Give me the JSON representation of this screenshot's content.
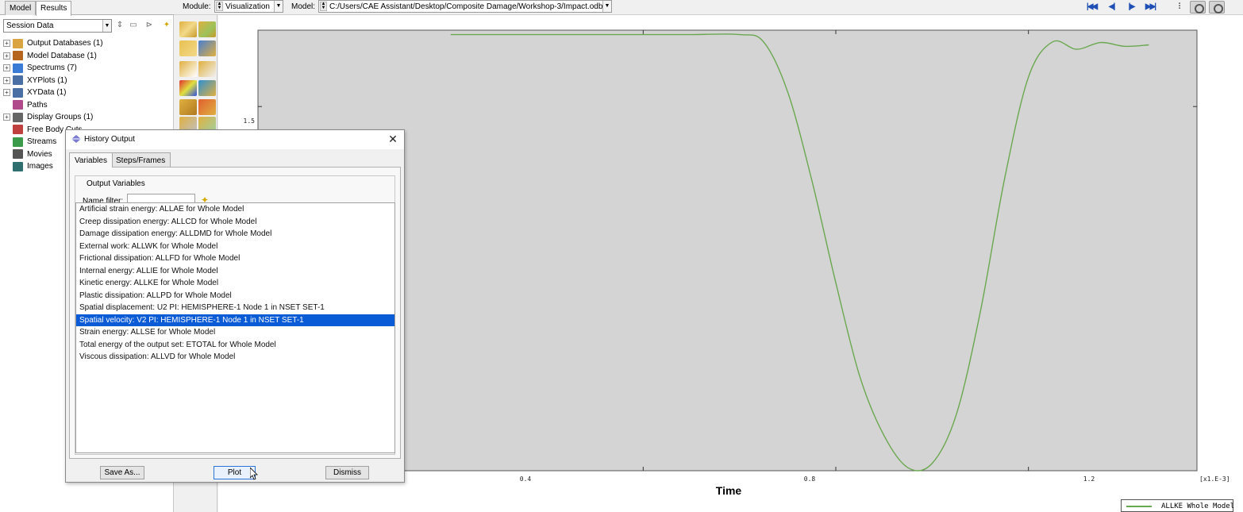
{
  "panel_tabs": [
    "Model",
    "Results"
  ],
  "session_select": "Session Data",
  "tree": [
    {
      "label": "Output Databases (1)",
      "expandable": true,
      "icon_color": "#d9a441"
    },
    {
      "label": "Model Database (1)",
      "expandable": true,
      "icon_color": "#b5651d"
    },
    {
      "label": "Spectrums (7)",
      "expandable": true,
      "icon_color": "#3a7bd5"
    },
    {
      "label": "XYPlots (1)",
      "expandable": true,
      "icon_color": "#4a6fa5"
    },
    {
      "label": "XYData (1)",
      "expandable": true,
      "icon_color": "#4a6fa5"
    },
    {
      "label": "Paths",
      "expandable": false,
      "icon_color": "#b04a8a"
    },
    {
      "label": "Display Groups (1)",
      "expandable": true,
      "icon_color": "#666666"
    },
    {
      "label": "Free Body Cuts",
      "expandable": false,
      "icon_color": "#c04040"
    },
    {
      "label": "Streams",
      "expandable": false,
      "icon_color": "#3b9b4a"
    },
    {
      "label": "Movies",
      "expandable": false,
      "icon_color": "#555555"
    },
    {
      "label": "Images",
      "expandable": false,
      "icon_color": "#2f6f6f"
    }
  ],
  "toolbar": {
    "module_label": "Module:",
    "module_value": "Visualization",
    "model_label": "Model:",
    "model_path": "C:/Users/CAE Assistant/Desktop/Composite Damage/Workshop-3/Impact.odb"
  },
  "dialog": {
    "title": "History Output",
    "tabs": [
      "Variables",
      "Steps/Frames"
    ],
    "group_label": "Output Variables",
    "filter_label": "Name filter:",
    "filter_value": "",
    "variables": [
      "Artificial strain energy: ALLAE for Whole Model",
      "Creep dissipation energy: ALLCD for Whole Model",
      "Damage dissipation energy: ALLDMD for Whole Model",
      "External work: ALLWK for Whole Model",
      "Frictional dissipation: ALLFD for Whole Model",
      "Internal energy: ALLIE for Whole Model",
      "Kinetic energy: ALLKE for Whole Model",
      "Plastic dissipation: ALLPD for Whole Model",
      "Spatial displacement: U2 PI: HEMISPHERE-1 Node 1 in NSET SET-1",
      "Spatial velocity: V2 PI: HEMISPHERE-1 Node 1 in NSET SET-1",
      "Strain energy: ALLSE for Whole Model",
      "Total energy of the output set: ETOTAL for Whole Model",
      "Viscous dissipation: ALLVD for Whole Model"
    ],
    "selected_index": 9,
    "buttons": {
      "save_as": "Save As...",
      "plot": "Plot",
      "dismiss": "Dismiss"
    }
  },
  "chart_data": {
    "type": "line",
    "xlabel": "Time",
    "x_tick_labels": [
      "0.4",
      "0.8",
      "1.2"
    ],
    "x_scale_label": "[x1.E-3]",
    "y_tick_labels": [
      "1.5"
    ],
    "series": [
      {
        "name": "ALLKE Whole Model",
        "color": "#6aa84f",
        "x": [
          0.0,
          0.2,
          0.4,
          0.5,
          0.6,
          0.65,
          0.7,
          0.75,
          0.8,
          0.85,
          0.9,
          0.95,
          1.0,
          1.05,
          1.1,
          1.15,
          1.2,
          1.25,
          1.3,
          1.35,
          1.4,
          1.45
        ],
        "y": [
          1.745,
          1.745,
          1.745,
          1.745,
          1.745,
          1.72,
          1.55,
          1.25,
          0.9,
          0.58,
          0.38,
          0.27,
          0.285,
          0.45,
          0.8,
          1.25,
          1.6,
          1.72,
          1.695,
          1.718,
          1.705,
          1.71
        ]
      }
    ],
    "xlim": [
      -0.4,
      1.55
    ],
    "ylim": [
      0.26,
      1.76
    ],
    "grid": false,
    "legend": "bottom-right"
  }
}
